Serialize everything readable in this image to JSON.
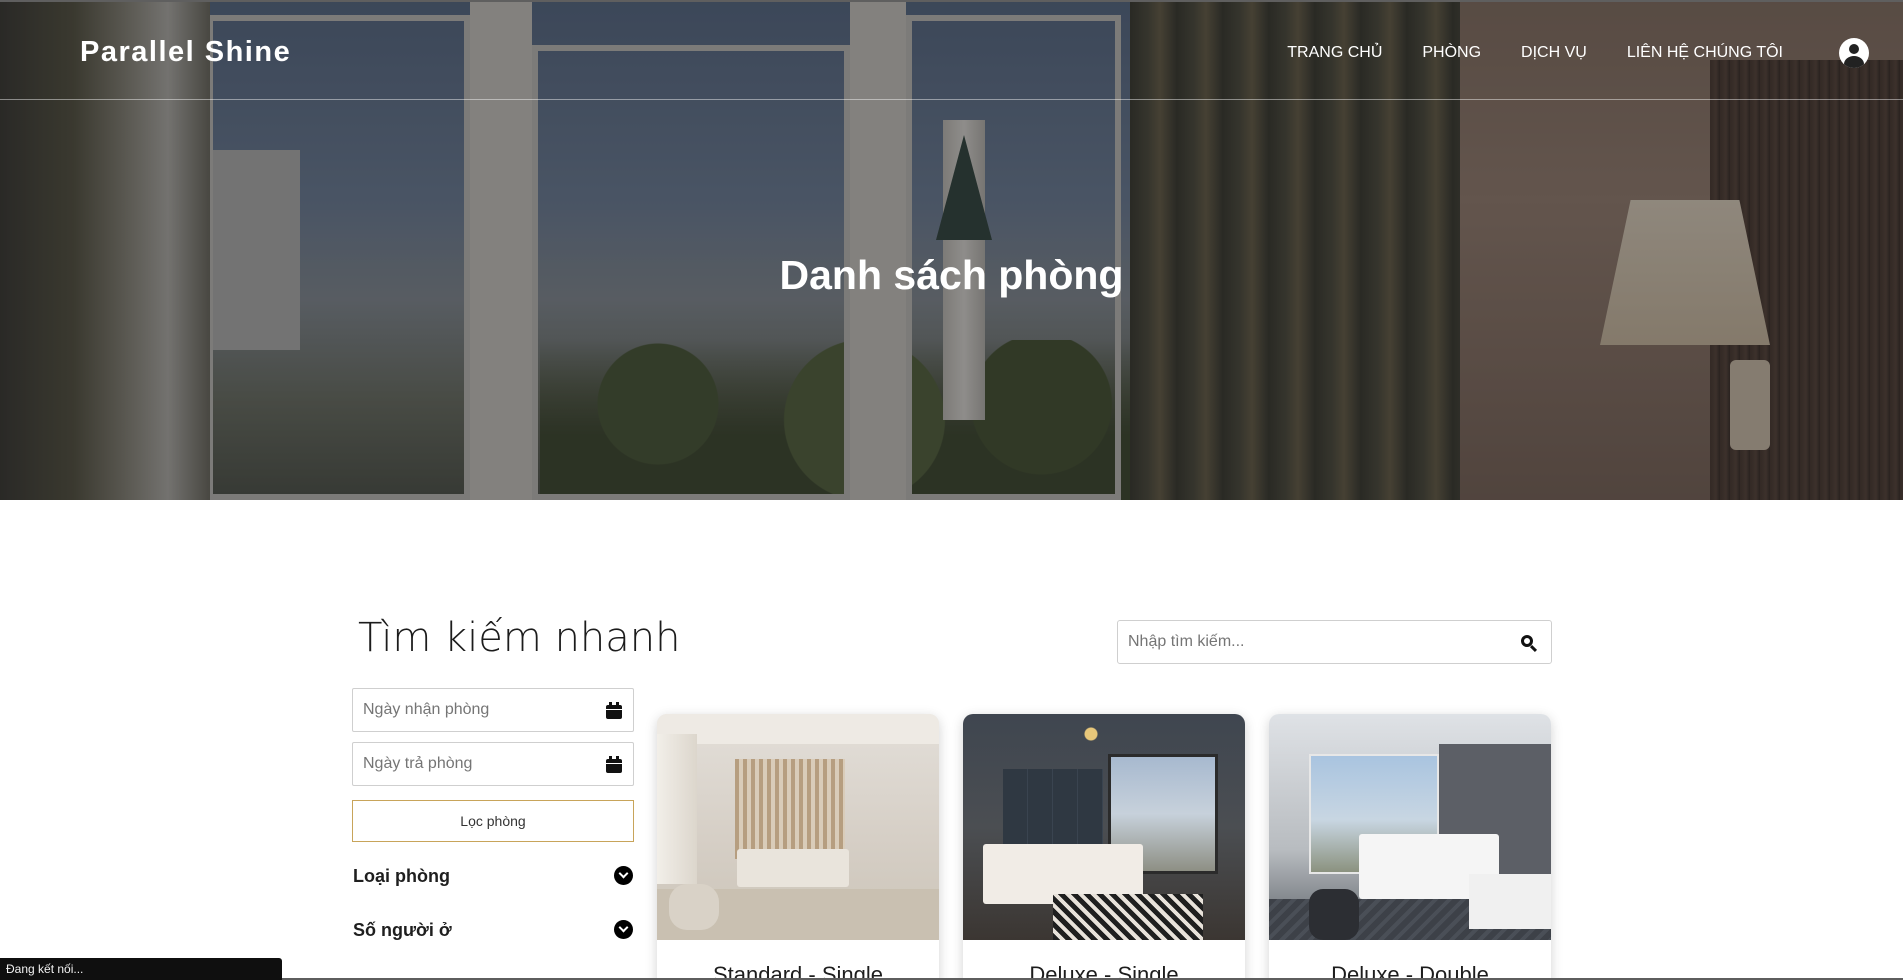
{
  "brand": "Parallel Shine",
  "nav": {
    "home": "TRANG CHỦ",
    "rooms": "PHÒNG",
    "services": "DỊCH VỤ",
    "contact": "LIÊN HỆ CHÚNG TÔI"
  },
  "hero": {
    "title": "Danh sách phòng"
  },
  "quick_search": {
    "title": "Tìm kiếm nhanh",
    "checkin_placeholder": "Ngày nhận phòng",
    "checkout_placeholder": "Ngày trả phòng",
    "filter_button": "Lọc phòng",
    "room_type_label": "Loại phòng",
    "guests_label": "Số người ở"
  },
  "search": {
    "placeholder": "Nhập tìm kiếm..."
  },
  "rooms": [
    {
      "title": "Standard - Single"
    },
    {
      "title": "Deluxe - Single"
    },
    {
      "title": "Deluxe - Double"
    }
  ],
  "status_bar": "Đang kết nối...",
  "icons": {
    "user": "user-circle-icon",
    "calendar": "calendar-icon",
    "chevron": "chevron-down-circle-icon",
    "search": "search-icon"
  },
  "colors": {
    "accent": "#c8a45a",
    "nav_text": "#ffffff",
    "status_bar": "#0f0f0f"
  }
}
